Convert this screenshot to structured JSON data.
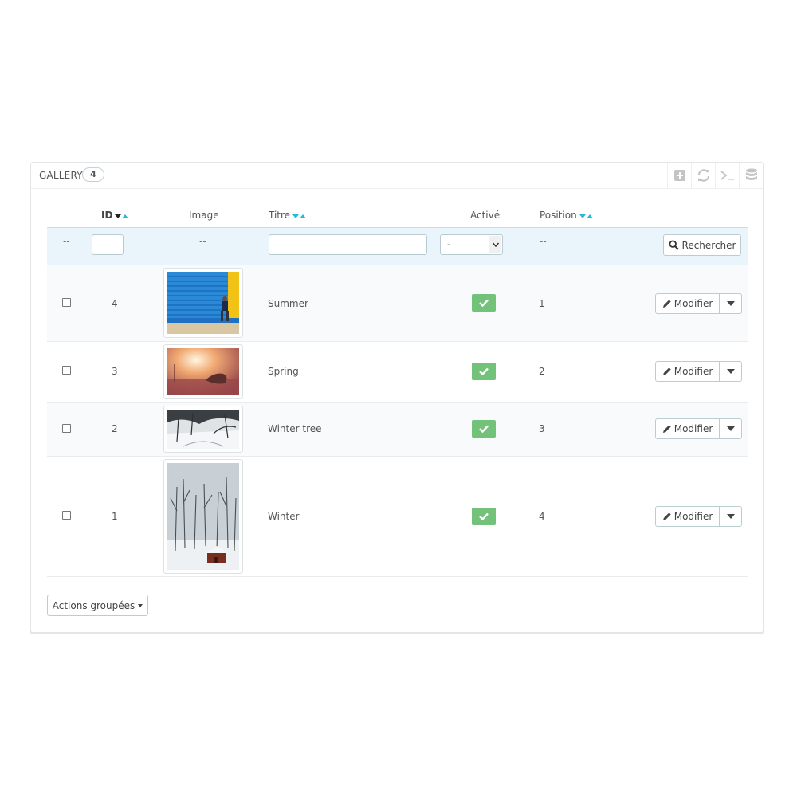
{
  "panel": {
    "title": "GALLERY",
    "count": "4"
  },
  "toolbar": {
    "icons": [
      "add-icon",
      "refresh-icon",
      "terminal-icon",
      "database-icon"
    ]
  },
  "columns": {
    "id": "ID",
    "image": "Image",
    "title": "Titre",
    "active": "Activé",
    "position": "Position"
  },
  "filters": {
    "id_placeholder": "--",
    "image_placeholder": "--",
    "position_placeholder": "--",
    "id_value": "",
    "title_value": "",
    "active_selected": "-",
    "search_label": "Rechercher"
  },
  "rows": [
    {
      "id": "4",
      "title": "Summer",
      "position": "1",
      "active": true,
      "image_icon": "summer-photo"
    },
    {
      "id": "3",
      "title": "Spring",
      "position": "2",
      "active": true,
      "image_icon": "spring-photo"
    },
    {
      "id": "2",
      "title": "Winter tree",
      "position": "3",
      "active": true,
      "image_icon": "winter-tree-photo"
    },
    {
      "id": "1",
      "title": "Winter",
      "position": "4",
      "active": true,
      "image_icon": "winter-photo"
    }
  ],
  "actions": {
    "edit_label": "Modifier",
    "bulk_label": "Actions groupées"
  },
  "colors": {
    "accent": "#25b9d7",
    "active": "#72c279",
    "filter_bg": "#eaf5fb"
  }
}
